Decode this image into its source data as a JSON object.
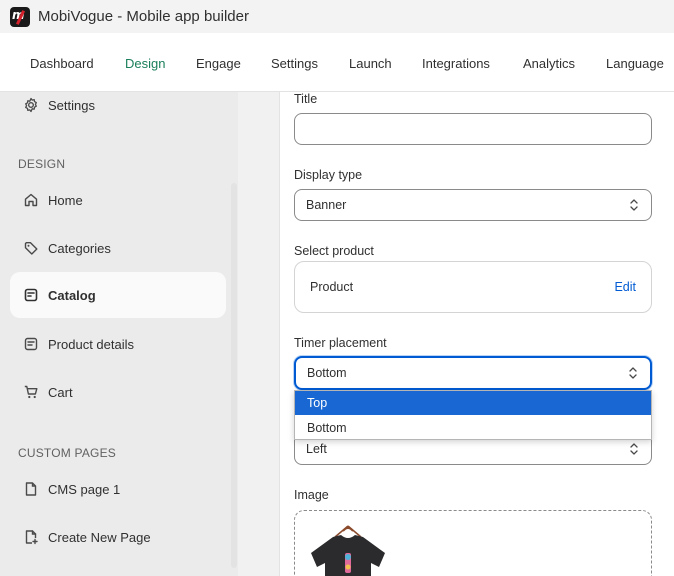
{
  "app": {
    "title": "MobiVogue - Mobile app builder"
  },
  "nav": {
    "tabs": [
      {
        "label": "Dashboard"
      },
      {
        "label": "Design"
      },
      {
        "label": "Engage"
      },
      {
        "label": "Settings"
      },
      {
        "label": "Launch"
      },
      {
        "label": "Integrations"
      },
      {
        "label": "Analytics"
      },
      {
        "label": "Language"
      }
    ],
    "active_tab": "Design"
  },
  "sidebar": {
    "top_item": {
      "label": "Settings",
      "icon": "gear-icon"
    },
    "design_header": "DESIGN",
    "design_items": [
      {
        "label": "Home",
        "icon": "home-icon"
      },
      {
        "label": "Categories",
        "icon": "categories-icon"
      },
      {
        "label": "Catalog",
        "icon": "catalog-icon"
      },
      {
        "label": "Product details",
        "icon": "product-details-icon"
      },
      {
        "label": "Cart",
        "icon": "cart-icon"
      }
    ],
    "active_item": "Catalog",
    "custom_header": "CUSTOM PAGES",
    "custom_items": [
      {
        "label": "CMS page 1",
        "icon": "page-icon"
      },
      {
        "label": "Create New Page",
        "icon": "page-add-icon"
      }
    ]
  },
  "form": {
    "title": {
      "label": "Title",
      "value": ""
    },
    "display_type": {
      "label": "Display type",
      "value": "Banner"
    },
    "select_product": {
      "label": "Select product",
      "product": "Product",
      "edit_label": "Edit"
    },
    "timer_placement": {
      "label": "Timer placement",
      "value": "Bottom",
      "options": [
        "Top",
        "Bottom"
      ],
      "highlighted": "Top"
    },
    "alignment": {
      "value": "Left"
    },
    "image": {
      "label": "Image",
      "thumbnail": "t-shirt-image"
    }
  },
  "colors": {
    "accent": "#005bd3",
    "active_tab": "#1a7f5a",
    "highlight": "#1967d2"
  }
}
